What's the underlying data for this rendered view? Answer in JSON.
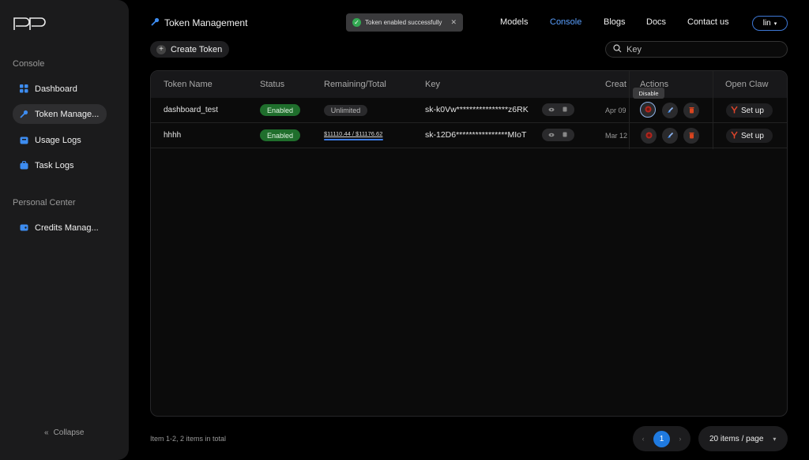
{
  "sidebar": {
    "sections": [
      {
        "title": "Console",
        "items": [
          {
            "label": "Dashboard",
            "icon": "grid-icon",
            "active": false
          },
          {
            "label": "Token Manage...",
            "icon": "key-icon",
            "active": true
          },
          {
            "label": "Usage Logs",
            "icon": "box-icon",
            "active": false
          },
          {
            "label": "Task Logs",
            "icon": "briefcase-icon",
            "active": false
          }
        ]
      },
      {
        "title": "Personal Center",
        "items": [
          {
            "label": "Credits Manag...",
            "icon": "wallet-icon",
            "active": false
          }
        ]
      }
    ],
    "collapse_label": "Collapse"
  },
  "header": {
    "title": "Token Management",
    "nav": [
      "Models",
      "Console",
      "Blogs",
      "Docs",
      "Contact us"
    ],
    "active_nav": "Console",
    "user": "lin"
  },
  "toast": {
    "message": "Token enabled successfully"
  },
  "toolbar": {
    "create_label": "Create Token",
    "search_placeholder": "Key"
  },
  "table": {
    "columns": [
      "Token Name",
      "Status",
      "Remaining/Total",
      "Key",
      "Creat",
      "Actions",
      "Open Claw"
    ],
    "rows": [
      {
        "name": "dashboard_test",
        "status": "Enabled",
        "quota": "Unlimited",
        "quota_type": "unlimited",
        "key": "sk-k0Vw****************z6RK",
        "created": "Apr 09",
        "setup": "Set up"
      },
      {
        "name": "hhhh",
        "status": "Enabled",
        "quota": "$11110.44 / $11176.62",
        "quota_type": "limited",
        "quota_fraction": 0.994,
        "key": "sk-12D6****************MIoT",
        "created": "Mar 12",
        "setup": "Set up"
      }
    ],
    "tooltip": "Disable"
  },
  "footer": {
    "total_text": "Item 1-2, 2 items in total",
    "current_page": "1",
    "per_page": "20 items / page"
  },
  "colors": {
    "accent": "#1f7ae0",
    "enabled": "#1f6e2c",
    "danger": "#d9451f",
    "link": "#5aa0ff"
  }
}
